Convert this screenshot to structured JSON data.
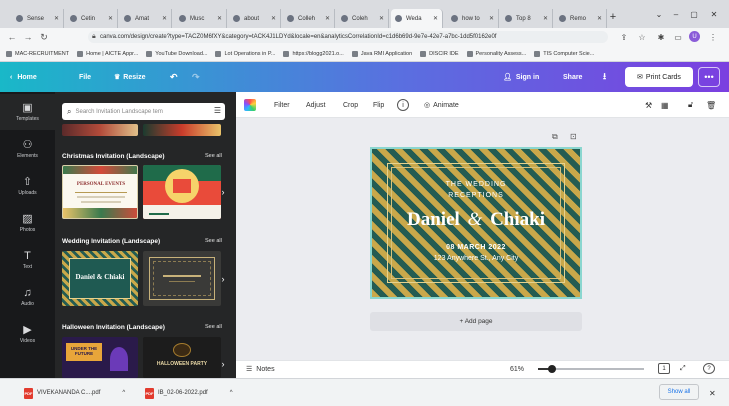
{
  "browser": {
    "tabs": [
      {
        "label": "Sense"
      },
      {
        "label": "Cetin"
      },
      {
        "label": "Amat"
      },
      {
        "label": "Musc"
      },
      {
        "label": "about"
      },
      {
        "label": "Colleh"
      },
      {
        "label": "Coleh"
      },
      {
        "label": "Weda"
      },
      {
        "label": "how to"
      },
      {
        "label": "Top 8"
      },
      {
        "label": "Remo"
      }
    ],
    "new_tab": "+",
    "url": "canva.com/design/create?type=TACZ0M6fXY&category=tACK4J1LDYd&locale=en&analyticsCorrelationId=c1d6b69d-9e7e-42e7-a7bc-1dd5f0162e0f",
    "profile_initial": "U",
    "bookmarks": [
      {
        "label": "MAC-RECRUITMENT"
      },
      {
        "label": "Home | AICTE Appr..."
      },
      {
        "label": "YouTube Download..."
      },
      {
        "label": "Lot Operations in P..."
      },
      {
        "label": "https://blogg2021.o..."
      },
      {
        "label": "Java RMI Application"
      },
      {
        "label": "DISCIR IDE"
      },
      {
        "label": "Personality Assess..."
      },
      {
        "label": "TIS Computer Scie..."
      }
    ]
  },
  "canva": {
    "header": {
      "home": "Home",
      "file": "File",
      "resize": "Resize",
      "sign_in": "Sign in",
      "share": "Share",
      "print": "Print Cards",
      "more": "•••"
    },
    "rail": [
      {
        "label": "Templates",
        "icon": "templates-icon"
      },
      {
        "label": "Elements",
        "icon": "elements-icon"
      },
      {
        "label": "Uploads",
        "icon": "uploads-icon"
      },
      {
        "label": "Photos",
        "icon": "photos-icon"
      },
      {
        "label": "Text",
        "icon": "text-icon"
      },
      {
        "label": "Audio",
        "icon": "audio-icon"
      },
      {
        "label": "Videos",
        "icon": "videos-icon"
      }
    ],
    "panel": {
      "search_placeholder": "Search Invitation Landscape tem",
      "sections": [
        {
          "title": "Christmas Invitation (Landscape)",
          "see_all": "See all",
          "thumb_text": "PERSONAL EVENTS"
        },
        {
          "title": "Wedding Invitation (Landscape)",
          "see_all": "See all",
          "thumb_text": "Daniel & Chiaki"
        },
        {
          "title": "Halloween Invitation (Landscape)",
          "see_all": "See all",
          "thumb_text_a": "UNDER THE FUTURE",
          "thumb_text_b": "HALLOWEEN PARTY"
        }
      ]
    },
    "toolbar": {
      "filter": "Filter",
      "adjust": "Adjust",
      "crop": "Crop",
      "flip": "Flip",
      "animate": "Animate"
    },
    "design": {
      "heading_line1": "THE WEDDING",
      "heading_line2": "RECEPTIONS",
      "name_left": "Daniel",
      "ampersand": "&",
      "name_right": "Chiaki",
      "date": "08 MARCH 2022",
      "address": "123 Anywhere St., Any City",
      "bg_color": "#1f5a52",
      "border_color": "#c9a84a"
    },
    "add_page": "+ Add page",
    "bottom": {
      "notes": "Notes",
      "zoom": "61%",
      "zoom_fraction": 0.13,
      "page_count": "1"
    }
  },
  "downloads": {
    "items": [
      {
        "name": "VIVEKANANDA C....pdf"
      },
      {
        "name": "IB_02-06-2022.pdf"
      }
    ],
    "show_all": "Show all"
  }
}
